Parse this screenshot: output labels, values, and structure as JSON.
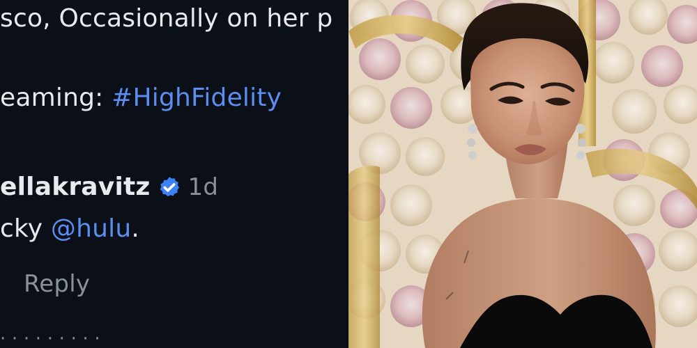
{
  "comment": {
    "text_line1": "sco, Occasionally on her p",
    "text_line2_prefix": "eaming: ",
    "hashtag": "#HighFidelity",
    "user": {
      "handle": "ellakravitz",
      "verified": true,
      "time_ago": "1d"
    },
    "reply_text_prefix": "cky ",
    "mention": "@hulu",
    "reply_text_suffix": ".",
    "reply_label": "Reply"
  },
  "photo": {
    "subject": "woman with slicked-back hair and black strapless outfit in front of a rose wall",
    "background": "flower wall of cream and pink roses with gold letter shapes"
  },
  "colors": {
    "dark_bg": "#0b0f17",
    "text": "#e8eaed",
    "link": "#5b8ef0",
    "muted": "#8b9199",
    "badge": "#3b82f6"
  }
}
